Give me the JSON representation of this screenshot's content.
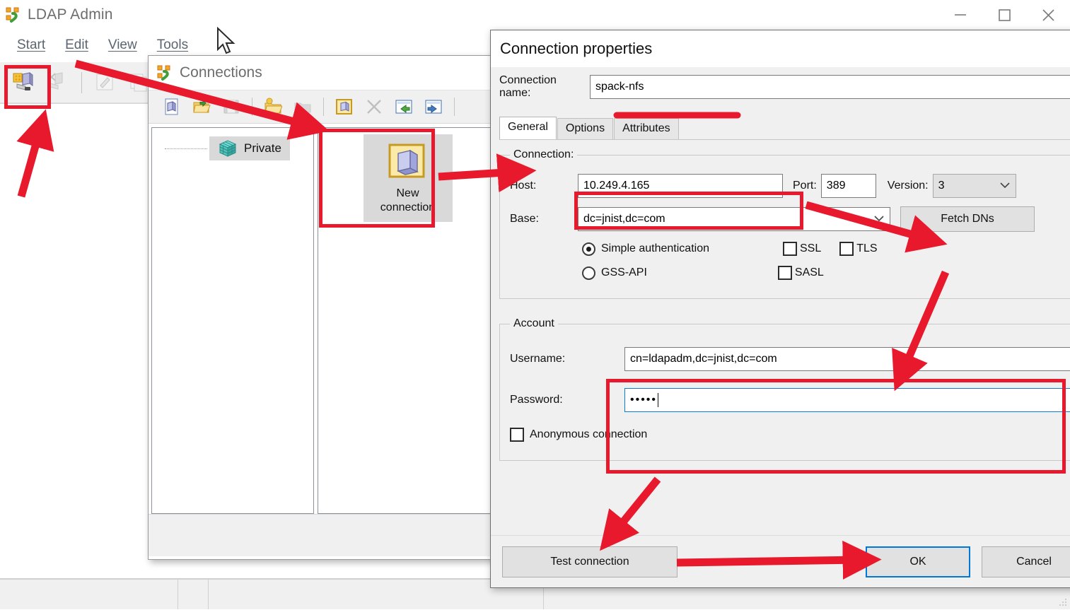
{
  "main_window": {
    "title": "LDAP Admin",
    "title_icon": "ldap-admin-icon",
    "window_controls": [
      {
        "name": "minimize-button",
        "glyph": "minimize-icon"
      },
      {
        "name": "maximize-button",
        "glyph": "maximize-icon"
      },
      {
        "name": "close-button",
        "glyph": "close-icon"
      }
    ],
    "menu": [
      {
        "label": "Start",
        "accel": "S"
      },
      {
        "label": "Edit",
        "accel": "E"
      },
      {
        "label": "View",
        "accel": "V"
      },
      {
        "label": "Tools",
        "accel": "T"
      }
    ],
    "toolbar": [
      {
        "name": "connect-button",
        "icon": "connect-server-icon",
        "enabled": true,
        "highlighted": true
      },
      {
        "name": "disconnect-button",
        "icon": "disconnect-server-icon",
        "enabled": false
      },
      {
        "name": "edit-entry-button",
        "icon": "pencil-edit-icon",
        "enabled": false
      },
      {
        "name": "copy-entry-button",
        "icon": "copy-entry-icon",
        "enabled": false
      }
    ],
    "statusbar": {
      "panels": [
        "",
        "",
        "",
        ""
      ]
    }
  },
  "connections_window": {
    "title": "Connections",
    "title_icon": "connections-icon",
    "toolbar": [
      {
        "name": "new-file-button",
        "icon": "new-document-icon",
        "enabled": true
      },
      {
        "name": "open-folder-button",
        "icon": "open-folder-icon",
        "enabled": true
      },
      {
        "name": "save-button",
        "icon": "save-disk-icon",
        "enabled": false
      },
      {
        "name": "new-folder-button",
        "icon": "new-folder-icon",
        "enabled": true
      },
      {
        "name": "delete-folder-button",
        "icon": "delete-folder-icon",
        "enabled": false
      },
      {
        "name": "new-connection-button",
        "icon": "new-connection-icon",
        "enabled": true
      },
      {
        "name": "remove-connection-button",
        "icon": "remove-x-icon",
        "enabled": false
      },
      {
        "name": "move-left-button",
        "icon": "arrow-left-icon",
        "enabled": true
      },
      {
        "name": "move-right-button",
        "icon": "arrow-right-icon",
        "enabled": true
      }
    ],
    "tree": [
      {
        "label": "Private",
        "icon": "private-cube-icon",
        "selected": true
      }
    ],
    "items": [
      {
        "label": "New\nconnection",
        "label_line1": "New",
        "label_line2": "connection",
        "icon": "new-connection-large-icon",
        "selected": true
      }
    ]
  },
  "dialog": {
    "title": "Connection properties",
    "close_label": "close-icon",
    "connection_name_label": "Connection name:",
    "connection_name_value": "spack-nfs",
    "tabs": [
      {
        "label": "General",
        "active": true
      },
      {
        "label": "Options",
        "active": false
      },
      {
        "label": "Attributes",
        "active": false
      }
    ],
    "connection_group": {
      "legend": "Connection:",
      "host_label": "Host:",
      "host_value": "10.249.4.165",
      "port_label": "Port:",
      "port_value": "389",
      "version_label": "Version:",
      "version_value": "3",
      "base_label": "Base:",
      "base_value": "dc=jnist,dc=com",
      "fetch_dns_label": "Fetch DNs",
      "auth_options": [
        {
          "label": "Simple authentication",
          "selected": true
        },
        {
          "label": "GSS-API",
          "selected": false
        }
      ],
      "security_options": [
        {
          "label": "SSL",
          "checked": false
        },
        {
          "label": "TLS",
          "checked": false
        },
        {
          "label": "SASL",
          "checked": false
        }
      ]
    },
    "account_group": {
      "legend": "Account",
      "username_label": "Username:",
      "username_value": "cn=ldapadm,dc=jnist,dc=com",
      "password_label": "Password:",
      "password_value": "•••••",
      "anonymous_label": "Anonymous connection",
      "anonymous_checked": false
    },
    "buttons": {
      "test_connection": "Test connection",
      "ok": "OK",
      "cancel": "Cancel"
    }
  },
  "annotations": {
    "color": "#e8192c",
    "highlight_boxes": [
      {
        "name": "highlight-connect-toolbar-button"
      },
      {
        "name": "highlight-new-connection-item"
      },
      {
        "name": "highlight-host-field"
      },
      {
        "name": "highlight-account-credentials"
      }
    ],
    "arrows": [
      {
        "name": "arrow-to-connect-button"
      },
      {
        "name": "arrow-to-new-connection"
      },
      {
        "name": "arrow-to-connection-group"
      },
      {
        "name": "arrow-to-fetch-dns"
      },
      {
        "name": "arrow-to-account-fields"
      },
      {
        "name": "arrow-to-test-connection"
      },
      {
        "name": "arrow-to-ok-button"
      }
    ],
    "underlines": [
      {
        "name": "underline-connection-name"
      }
    ]
  }
}
